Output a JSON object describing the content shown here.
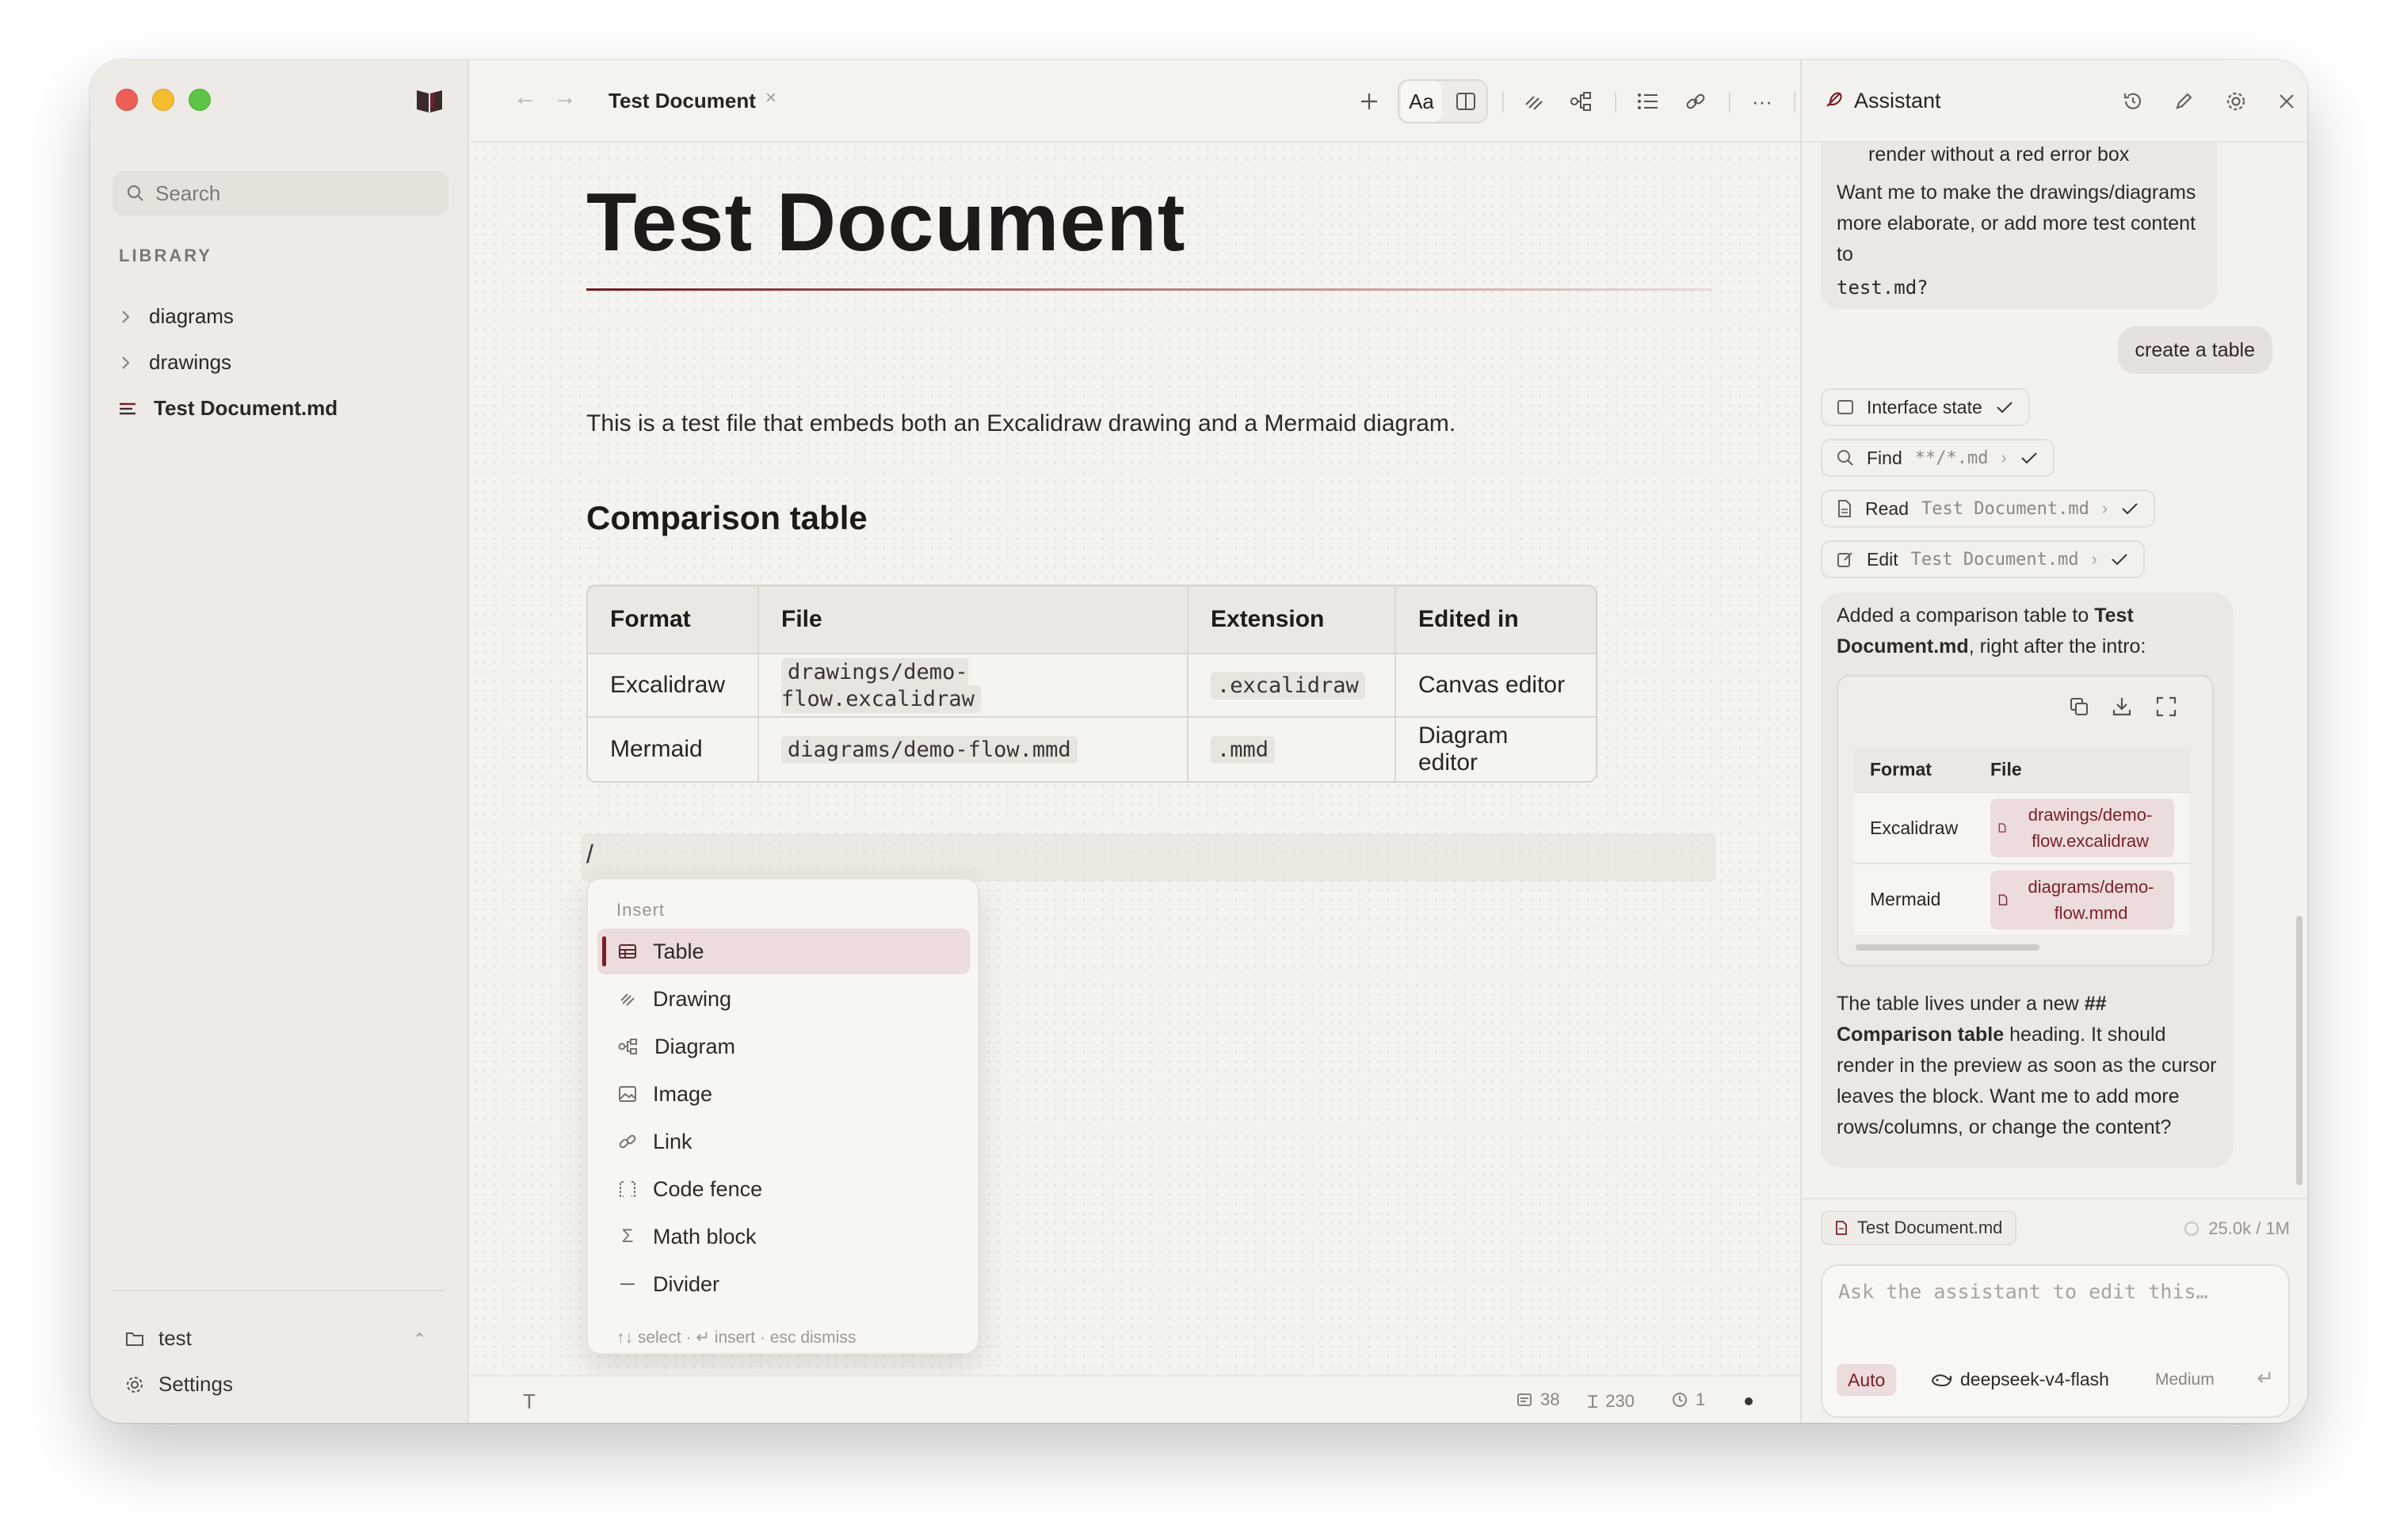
{
  "sidebar": {
    "search_placeholder": "Search",
    "library_heading": "LIBRARY",
    "items": [
      {
        "label": "diagrams",
        "icon": "chevron-right-icon"
      },
      {
        "label": "drawings",
        "icon": "chevron-right-icon"
      },
      {
        "label": "Test Document.md",
        "icon": "document-lines-icon",
        "active": true
      }
    ],
    "workspace": "test",
    "settings": "Settings"
  },
  "toolbar": {
    "tab_title": "Test Document",
    "tab_close": "×",
    "font_button": "Aa",
    "more": "···"
  },
  "editor": {
    "title": "Test Document",
    "intro": "This is a test file that embeds both an Excalidraw drawing and a Mermaid diagram.",
    "heading": "Comparison table",
    "table": {
      "headers": [
        "Format",
        "File",
        "Extension",
        "Edited in"
      ],
      "rows": [
        [
          "Excalidraw",
          "drawings/demo-flow.excalidraw",
          ".excalidraw",
          "Canvas editor"
        ],
        [
          "Mermaid",
          "diagrams/demo-flow.mmd",
          ".mmd",
          "Diagram editor"
        ]
      ]
    },
    "slash_text": "/",
    "insert_menu": {
      "heading": "Insert",
      "items": [
        "Table",
        "Drawing",
        "Diagram",
        "Image",
        "Link",
        "Code fence",
        "Math block",
        "Divider"
      ],
      "selected": "Table",
      "footer": "↑↓ select · ↵ insert · esc dismiss"
    }
  },
  "status": {
    "words": "38",
    "chars": "230",
    "history": "1"
  },
  "assistant": {
    "title": "Assistant",
    "prev_message_tail": "render without a red error box",
    "prev_message_q": "Want me to make the drawings/diagrams more elaborate, or add more test content to",
    "prev_message_file": "test.md?",
    "user_message": "create a table",
    "tools": [
      {
        "name": "Interface state",
        "arg": "",
        "icon": "window-icon"
      },
      {
        "name": "Find",
        "arg": "**/*.md",
        "icon": "search-icon"
      },
      {
        "name": "Read",
        "arg": "Test Document.md",
        "icon": "file-icon"
      },
      {
        "name": "Edit",
        "arg": "Test Document.md",
        "icon": "edit-icon"
      }
    ],
    "reply_intro_a": "Added a comparison table to ",
    "reply_intro_b": "Test Document.md",
    "reply_intro_c": ", right after the intro:",
    "preview_table": {
      "headers": [
        "Format",
        "File"
      ],
      "rows": [
        [
          "Excalidraw",
          "drawings/demo-flow.excalidraw"
        ],
        [
          "Mermaid",
          "diagrams/demo-flow.mmd"
        ]
      ]
    },
    "reply_outro_a": "The table lives under a new ",
    "reply_outro_b": "## Comparison table",
    "reply_outro_c": " heading. It should render in the preview as soon as the cursor leaves the block. Want me to add more rows/columns, or change the content?",
    "context_file": "Test Document.md",
    "tokens": "25.0k / 1M",
    "input_placeholder": "Ask the assistant to edit this…",
    "mode": "Auto",
    "model": "deepseek-v4-flash",
    "effort": "Medium"
  },
  "colors": {
    "accent": "#7a1f27",
    "accent_soft": "#ecdcdc",
    "background": "#f5f3ef",
    "sidebar": "#eeebe6"
  }
}
